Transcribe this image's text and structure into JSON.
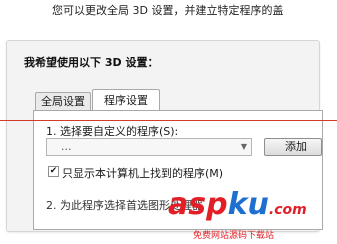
{
  "header": {
    "intro_text": "您可以更改全局 3D 设置，并建立特定程序的盖"
  },
  "panel": {
    "question": "我希望使用以下 3D 设置："
  },
  "tabs": [
    {
      "label": "全局设置",
      "active": false
    },
    {
      "label": "程序设置",
      "active": true
    }
  ],
  "program_settings": {
    "step1_label": "1.  选择要自定义的程序(S):",
    "program_select_value": "...",
    "add_button_label": "添加",
    "checkbox_label": "只显示本计算机上找到的程序(M)",
    "checkbox_checked": true,
    "step2_label": "2.  为此程序选择首选图形处理器"
  },
  "watermark": {
    "asp": "asp",
    "ku": "ku",
    "net": ".com",
    "sub": "免费网站源码下载站"
  },
  "colors": {
    "accent_red": "#d23a2a",
    "watermark_red": "#e21f26",
    "watermark_blue": "#1f6fd1"
  }
}
